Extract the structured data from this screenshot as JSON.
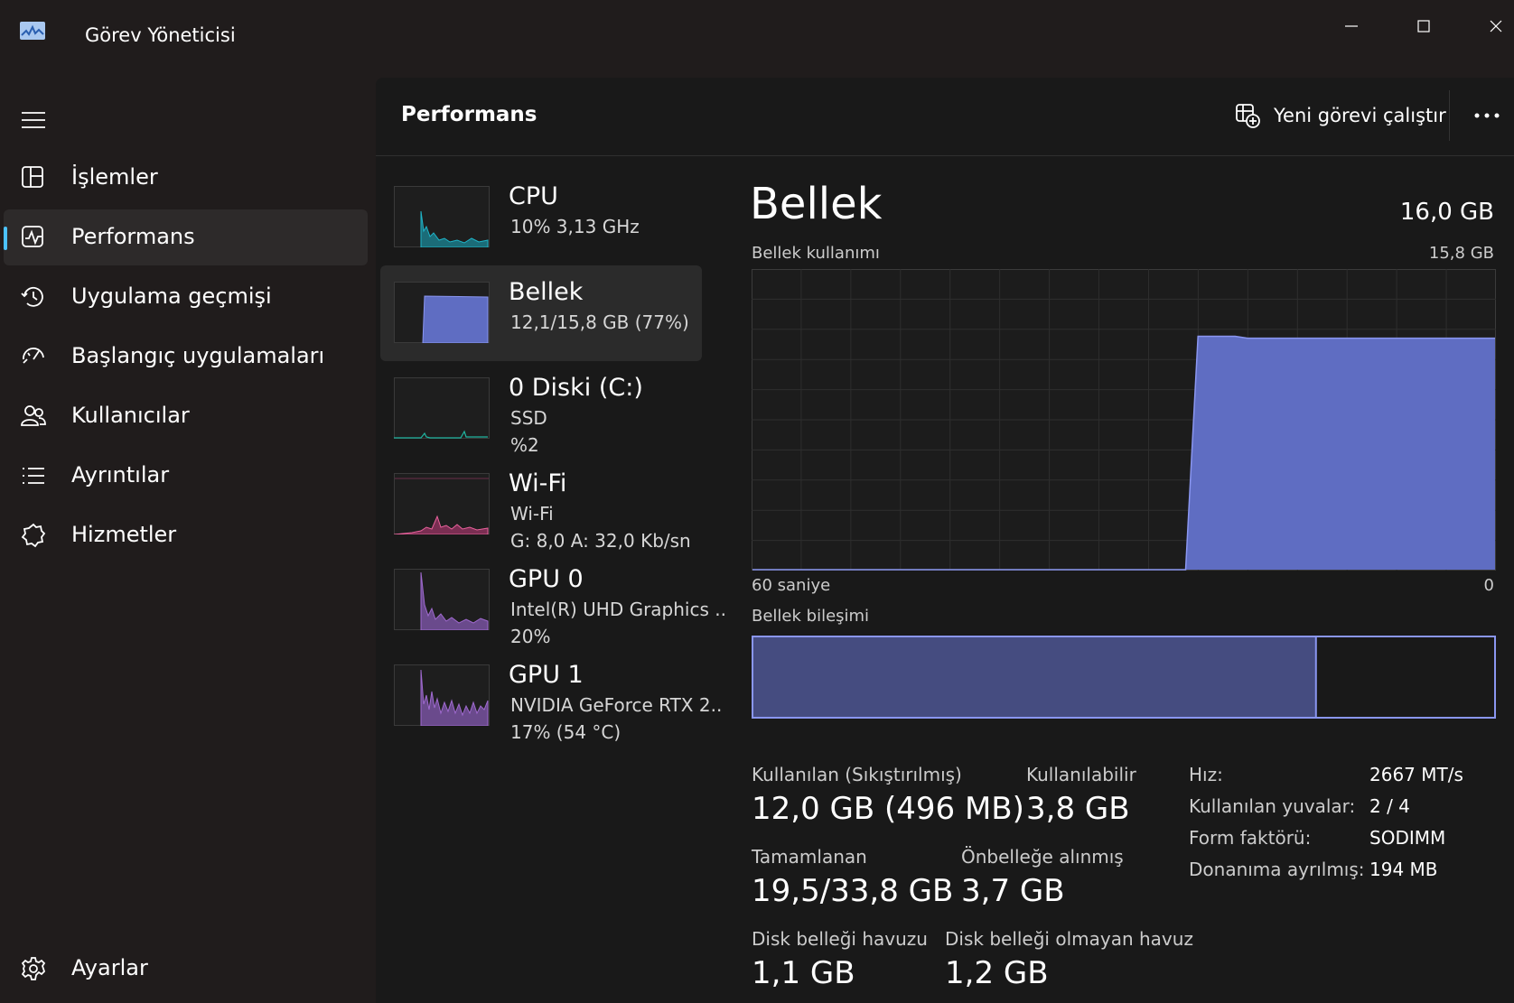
{
  "window": {
    "title": "Görev Yöneticisi"
  },
  "sidebar": {
    "items": [
      {
        "label": "İşlemler",
        "icon": "processes-icon"
      },
      {
        "label": "Performans",
        "icon": "performance-icon"
      },
      {
        "label": "Uygulama geçmişi",
        "icon": "history-icon"
      },
      {
        "label": "Başlangıç uygulamaları",
        "icon": "startup-icon"
      },
      {
        "label": "Kullanıcılar",
        "icon": "users-icon"
      },
      {
        "label": "Ayrıntılar",
        "icon": "details-icon"
      },
      {
        "label": "Hizmetler",
        "icon": "services-icon"
      }
    ],
    "settings_label": "Ayarlar"
  },
  "header": {
    "title": "Performans",
    "run_task_label": "Yeni görevi çalıştır"
  },
  "devices": [
    {
      "name": "CPU",
      "line1": "10%  3,13 GHz",
      "line2": "",
      "color": "#1fb5c9"
    },
    {
      "name": "Bellek",
      "line1": "12,1/15,8 GB (77%)",
      "line2": "",
      "color": "#6c7ee0"
    },
    {
      "name": "0 Diski (C:)",
      "line1": "SSD",
      "line2": "%2",
      "color": "#1fb5a0"
    },
    {
      "name": "Wi-Fi",
      "line1": "Wi-Fi",
      "line2": "G: 8,0  A: 32,0 Kb/sn",
      "color": "#e8629c"
    },
    {
      "name": "GPU 0",
      "line1": "Intel(R) UHD Graphics ..",
      "line2": "20%",
      "color": "#a06ad0"
    },
    {
      "name": "GPU 1",
      "line1": "NVIDIA GeForce RTX 2..",
      "line2": "17%  (54 °C)",
      "color": "#a06ad0"
    }
  ],
  "detail": {
    "title": "Bellek",
    "total": "16,0 GB",
    "usage_label": "Bellek kullanımı",
    "usage_max": "15,8 GB",
    "axis_left": "60 saniye",
    "axis_right": "0",
    "composition_label": "Bellek bileşimi",
    "stats": {
      "used_label": "Kullanılan (Sıkıştırılmış)",
      "used_value": "12,0 GB (496 MB)",
      "available_label": "Kullanılabilir",
      "available_value": "3,8 GB",
      "committed_label": "Tamamlanan",
      "committed_value": "19,5/33,8 GB",
      "cached_label": "Önbelleğe alınmış",
      "cached_value": "3,7 GB",
      "paged_label": "Disk belleği havuzu",
      "paged_value": "1,1 GB",
      "nonpaged_label": "Disk belleği olmayan havuz",
      "nonpaged_value": "1,2 GB"
    },
    "props": [
      {
        "label": "Hız:",
        "value": "2667 MT/s"
      },
      {
        "label": "Kullanılan yuvalar:",
        "value": "2 / 4"
      },
      {
        "label": "Form faktörü:",
        "value": "SODIMM"
      },
      {
        "label": "Donanıma ayrılmış:",
        "value": "194 MB"
      }
    ]
  },
  "colors": {
    "accent": "#4cc2ff",
    "memory_fill": "#5f6dc2",
    "memory_line": "#8a96f0"
  },
  "chart_data": {
    "type": "area",
    "title": "",
    "xlabel": "",
    "ylabel": "",
    "x_range_label": [
      "60 saniye",
      "0"
    ],
    "ylim": [
      0,
      15.8
    ],
    "series": [
      {
        "values": [
          0,
          0,
          0,
          0,
          0,
          0,
          0,
          0,
          0,
          0,
          0,
          0,
          0,
          0,
          0,
          0,
          0,
          0,
          0,
          0,
          0,
          0,
          0,
          0,
          0,
          0,
          0,
          0,
          0,
          0,
          0,
          0,
          0,
          0,
          0,
          0,
          12.3,
          12.3,
          12.3,
          12.3,
          12.2,
          12.2,
          12.2,
          12.2,
          12.2,
          12.2,
          12.2,
          12.2,
          12.2,
          12.2,
          12.2,
          12.2,
          12.2,
          12.2,
          12.2,
          12.2,
          12.2,
          12.2,
          12.2,
          12.2,
          12.2
        ]
      }
    ],
    "composition": {
      "in_use_gb": 12.0,
      "total_gb": 15.8
    }
  }
}
